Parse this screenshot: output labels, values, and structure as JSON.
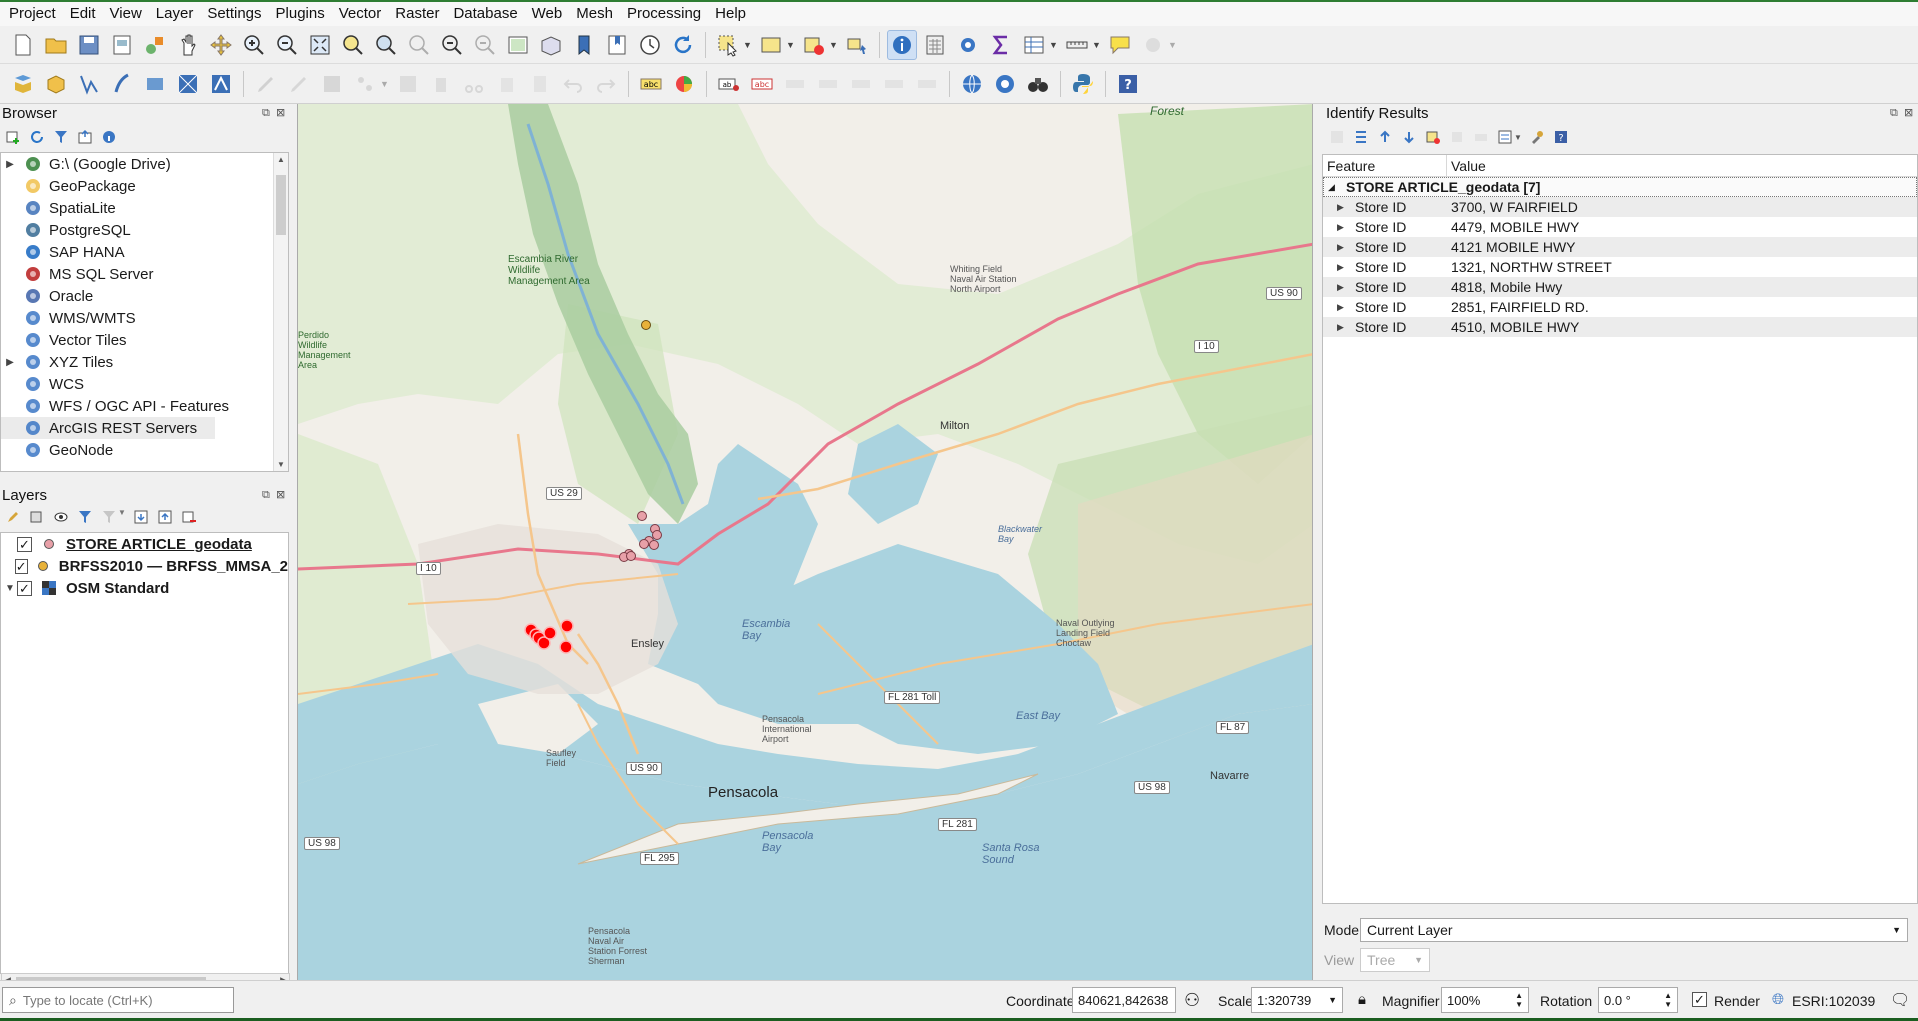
{
  "menubar": [
    "Project",
    "Edit",
    "View",
    "Layer",
    "Settings",
    "Plugins",
    "Vector",
    "Raster",
    "Database",
    "Web",
    "Mesh",
    "Processing",
    "Help"
  ],
  "browser": {
    "title": "Browser",
    "items": [
      {
        "label": "G:\\ (Google Drive)",
        "icon": "drive-icon",
        "expandable": true
      },
      {
        "label": "GeoPackage",
        "icon": "geopackage-icon",
        "expandable": false
      },
      {
        "label": "SpatiaLite",
        "icon": "spatialite-icon",
        "expandable": false
      },
      {
        "label": "PostgreSQL",
        "icon": "postgresql-icon",
        "expandable": false
      },
      {
        "label": "SAP HANA",
        "icon": "sap-hana-icon",
        "expandable": false
      },
      {
        "label": "MS SQL Server",
        "icon": "mssql-icon",
        "expandable": false
      },
      {
        "label": "Oracle",
        "icon": "oracle-icon",
        "expandable": false
      },
      {
        "label": "WMS/WMTS",
        "icon": "wms-icon",
        "expandable": false
      },
      {
        "label": "Vector Tiles",
        "icon": "vector-tiles-icon",
        "expandable": false
      },
      {
        "label": "XYZ Tiles",
        "icon": "xyz-tiles-icon",
        "expandable": true
      },
      {
        "label": "WCS",
        "icon": "wcs-icon",
        "expandable": false
      },
      {
        "label": "WFS / OGC API - Features",
        "icon": "wfs-icon",
        "expandable": false
      },
      {
        "label": "ArcGIS REST Servers",
        "icon": "arcgis-icon",
        "expandable": false
      },
      {
        "label": "GeoNode",
        "icon": "geonode-icon",
        "expandable": false
      }
    ]
  },
  "layers": {
    "title": "Layers",
    "items": [
      {
        "label": "STORE ARTICLE_geodata",
        "checked": true,
        "symbol": "pink-dot",
        "underline": true
      },
      {
        "label": "BRFSS2010 — BRFSS_MMSA_2",
        "checked": true,
        "symbol": "orange-dot",
        "underline": false
      },
      {
        "label": "OSM Standard",
        "checked": true,
        "symbol": "tiles",
        "underline": false
      }
    ]
  },
  "map": {
    "labels": {
      "forest": "Forest",
      "escambia_river": "Escambia River Wildlife Management Area",
      "whiting_field": "Whiting Field Naval Air Station North Airport",
      "us90_ne": "US 90",
      "i10_e": "I 10",
      "milton": "Milton",
      "us29": "US 29",
      "i10_w": "I 10",
      "blackwater_bay": "Blackwater Bay",
      "escambia_bay": "Escambia Bay",
      "ensley": "Ensley",
      "fl281_toll": "FL 281 Toll",
      "pensacola_airport": "Pensacola International Airport",
      "naval_outlying": "Naval Outlying Landing Field Choctaw",
      "east_bay": "East Bay",
      "fl87": "FL 87",
      "navarre": "Navarre",
      "us98_e": "US 98",
      "saufley": "Saufley Field",
      "pensacola": "Pensacola",
      "fl281": "FL 281",
      "pensacola_bay": "Pensacola Bay",
      "santa_rosa_sound": "Santa Rosa Sound",
      "us98_w": "US 98",
      "fl295": "FL 295",
      "nas_pensacola": "Pensacola Naval Air Station Forrest Sherman",
      "perdido": "Perdido Wildlife Management Area",
      "us90_w": "US 90"
    }
  },
  "identify": {
    "title": "Identify Results",
    "col_feature": "Feature",
    "col_value": "Value",
    "layer_label": "STORE ARTICLE_geodata  [7]",
    "rows": [
      {
        "feature": "Store ID",
        "value": "3700, W FAIRFIELD"
      },
      {
        "feature": "Store ID",
        "value": "4479, MOBILE HWY"
      },
      {
        "feature": "Store ID",
        "value": "4121 MOBILE HWY"
      },
      {
        "feature": "Store ID",
        "value": "1321, NORTHW STREET"
      },
      {
        "feature": "Store ID",
        "value": "4818, Mobile Hwy"
      },
      {
        "feature": "Store ID",
        "value": "2851, FAIRFIELD RD."
      },
      {
        "feature": "Store ID",
        "value": "4510, MOBILE HWY"
      }
    ],
    "mode_label": "Mode",
    "mode_value": "Current Layer",
    "view_label": "View",
    "view_value": "Tree"
  },
  "statusbar": {
    "locator_placeholder": "Type to locate (Ctrl+K)",
    "coordinate_label": "Coordinate",
    "coordinate_value": "840621,842638",
    "scale_label": "Scale",
    "scale_value": "1:320739",
    "magnifier_label": "Magnifier",
    "magnifier_value": "100%",
    "rotation_label": "Rotation",
    "rotation_value": "0.0 °",
    "render_label": "Render",
    "crs_label": "ESRI:102039"
  },
  "colors": {
    "store_point": "#e8a0a8",
    "store_selected": "#ff0000",
    "brfss_point": "#e8b23a",
    "water": "#aad3df",
    "land": "#f2efe9",
    "forest": "#cfe3bd"
  }
}
